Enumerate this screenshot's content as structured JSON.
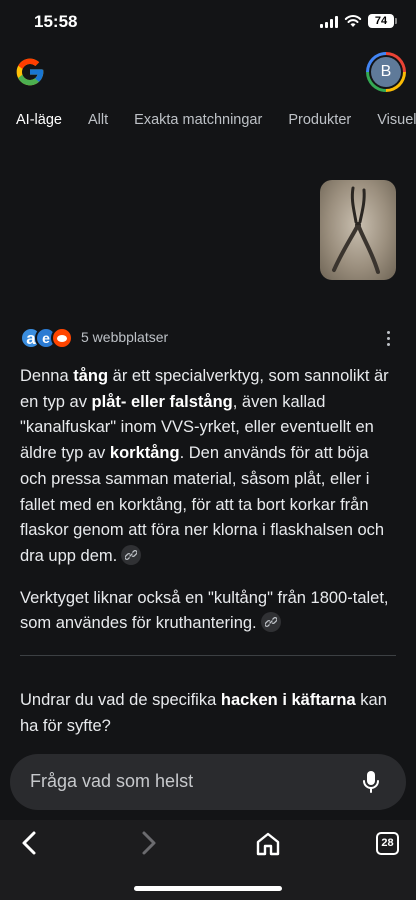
{
  "status_bar": {
    "time": "15:58",
    "battery": "74"
  },
  "header": {
    "logo_icon": "google-g-icon",
    "avatar_letter": "B"
  },
  "tabs": [
    {
      "label": "AI-läge",
      "active": true
    },
    {
      "label": "Allt"
    },
    {
      "label": "Exakta matchningar"
    },
    {
      "label": "Produkter"
    },
    {
      "label": "Visuella"
    }
  ],
  "query_image": {
    "alt": "tång"
  },
  "sources": {
    "count_label": "5 webbplatser",
    "icons": [
      "a",
      "e",
      "reddit-icon"
    ]
  },
  "answer": {
    "p1": [
      {
        "t": "Denna "
      },
      {
        "t": "tång",
        "b": true
      },
      {
        "t": " är ett specialverktyg, som sannolikt är en typ av "
      },
      {
        "t": "plåt- eller falstång",
        "b": true
      },
      {
        "t": ", även kallad \"kanalfuskar\" inom VVS-yrket, eller eventuellt en äldre typ av "
      },
      {
        "t": "korktång",
        "b": true
      },
      {
        "t": ". Den används för att böja och pressa samman material, såsom plåt, eller i fallet med en korktång, för att ta bort korkar från flaskor genom att föra ner klorna i flaskhalsen och dra upp dem."
      }
    ],
    "p2": "Verktyget liknar också en \"kultång\" från 1800-talet, som användes för kruthantering."
  },
  "followup": [
    {
      "t": "Undrar du vad de specifika "
    },
    {
      "t": "hacken i käftarna",
      "b": true
    },
    {
      "t": " kan ha för syfte?"
    }
  ],
  "ask": {
    "placeholder": "Fråga vad som helst"
  },
  "toolbar": {
    "tab_count": "28"
  },
  "colors": {
    "background": "#131416",
    "text": "#e8eaed",
    "chip": "#303134",
    "ask_bar": "#2a2b2e"
  }
}
